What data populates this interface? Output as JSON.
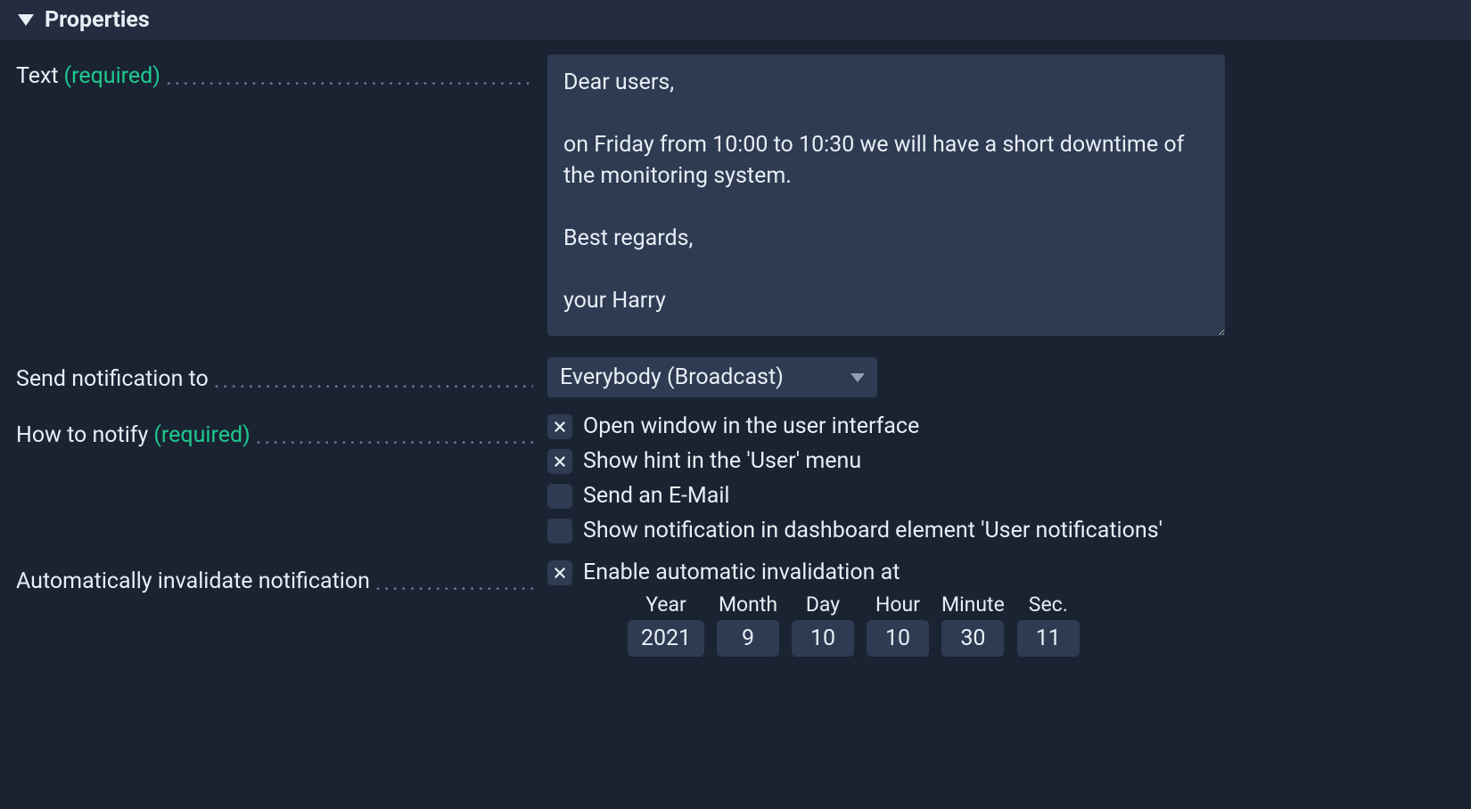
{
  "panel": {
    "title": "Properties"
  },
  "form": {
    "text": {
      "label": "Text",
      "required": "(required)",
      "value": "Dear users,\n\non Friday from 10:00 to 10:30 we will have a short downtime of the monitoring system.\n\nBest regards,\n\nyour Harry"
    },
    "send_to": {
      "label": "Send notification to",
      "selected": "Everybody (Broadcast)"
    },
    "how_to_notify": {
      "label": "How to notify",
      "required": "(required)",
      "options": [
        {
          "label": "Open window in the user interface",
          "checked": true
        },
        {
          "label": "Show hint in the 'User' menu",
          "checked": true
        },
        {
          "label": "Send an E-Mail",
          "checked": false
        },
        {
          "label": "Show notification in dashboard element 'User notifications'",
          "checked": false
        }
      ]
    },
    "auto_invalidate": {
      "label": "Automatically invalidate notification",
      "enable_label": "Enable automatic invalidation at",
      "enable_checked": true,
      "datetime": {
        "year": {
          "label": "Year",
          "value": "2021"
        },
        "month": {
          "label": "Month",
          "value": "9"
        },
        "day": {
          "label": "Day",
          "value": "10"
        },
        "hour": {
          "label": "Hour",
          "value": "10"
        },
        "minute": {
          "label": "Minute",
          "value": "30"
        },
        "sec": {
          "label": "Sec.",
          "value": "11"
        }
      }
    }
  },
  "dots": ".............................................................."
}
